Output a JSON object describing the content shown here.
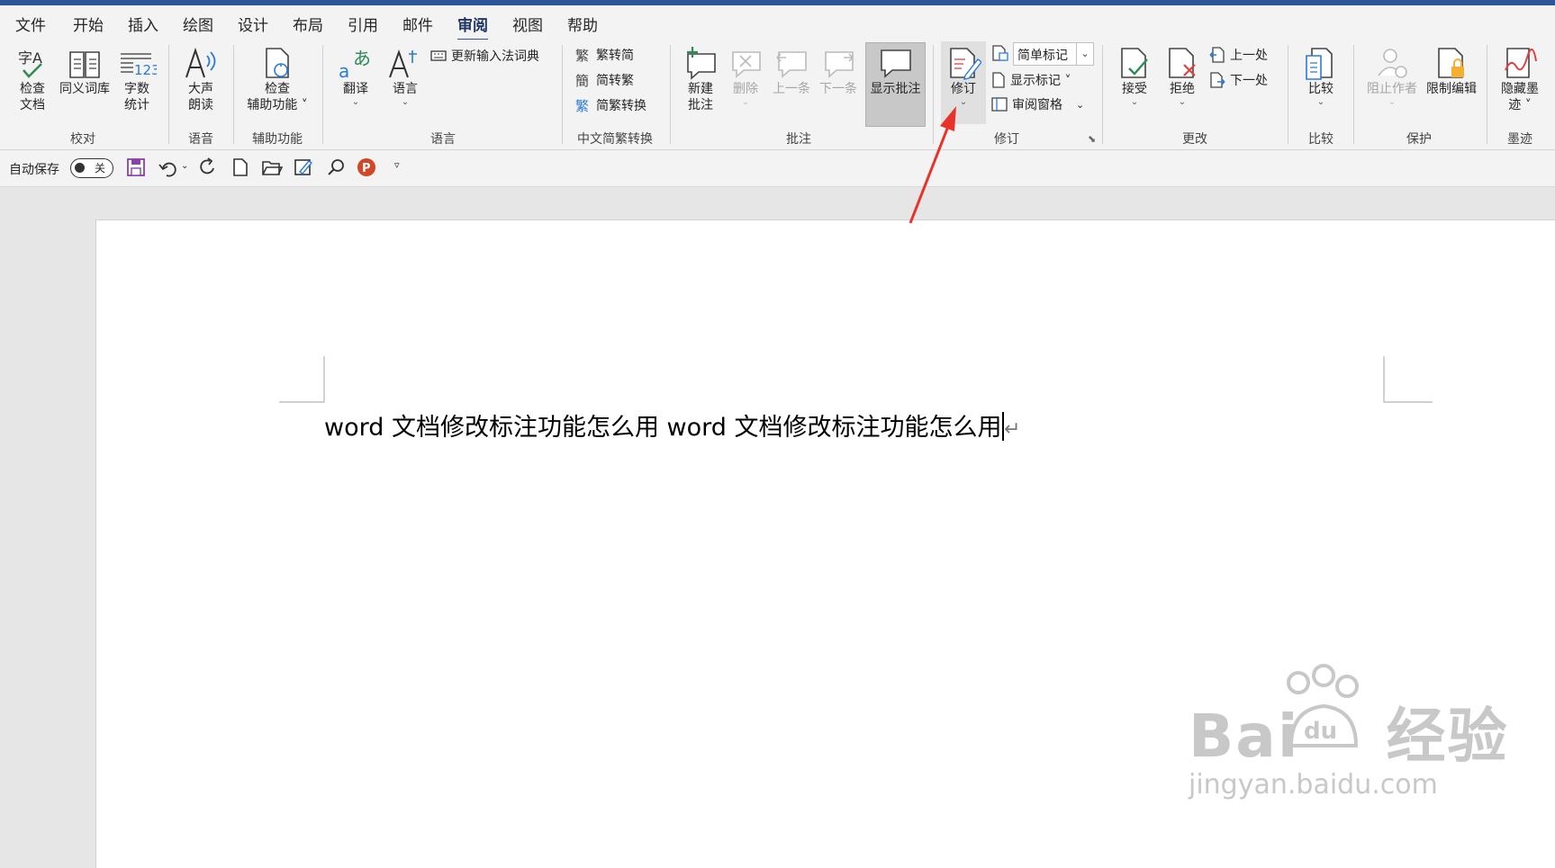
{
  "tabs": [
    {
      "label": "文件",
      "active": false
    },
    {
      "label": "开始",
      "active": false
    },
    {
      "label": "插入",
      "active": false
    },
    {
      "label": "绘图",
      "active": false
    },
    {
      "label": "设计",
      "active": false
    },
    {
      "label": "布局",
      "active": false
    },
    {
      "label": "引用",
      "active": false
    },
    {
      "label": "邮件",
      "active": false
    },
    {
      "label": "审阅",
      "active": true
    },
    {
      "label": "视图",
      "active": false
    },
    {
      "label": "帮助",
      "active": false
    }
  ],
  "ribbon": {
    "proofing": {
      "check_doc": "检查\n文档",
      "thesaurus": "同义词库",
      "word_count": "字数\n统计",
      "group": "校对",
      "icon_text_check": "字A",
      "icon_text_count": "123"
    },
    "speech": {
      "read_aloud": "大声\n朗读",
      "group": "语音"
    },
    "accessibility": {
      "check": "检查\n辅助功能 ˅",
      "group": "辅助功能"
    },
    "language": {
      "translate": "翻译",
      "language": "语言",
      "update_ime": "更新输入法词典",
      "group": "语言",
      "icon_translate_a": "a",
      "icon_translate_b": "あ"
    },
    "chinese": {
      "trad_to_simp": "繁转简",
      "simp_to_trad": "简转繁",
      "convert": "简繁转换",
      "group": "中文简繁转换",
      "icon_trad": "繁",
      "icon_simp": "簡",
      "icon_convert": "繁"
    },
    "comments": {
      "new": "新建\n批注",
      "delete": "删除",
      "previous": "上一条",
      "next": "下一条",
      "show": "显示批注",
      "group": "批注"
    },
    "tracking": {
      "track_changes": "修订",
      "markup_mode": "简单标记",
      "show_markup": "显示标记 ˅",
      "reviewing_pane": "审阅窗格",
      "group": "修订"
    },
    "changes": {
      "accept": "接受",
      "reject": "拒绝",
      "previous": "上一处",
      "next": "下一处",
      "group": "更改"
    },
    "compare": {
      "compare": "比较",
      "group": "比较"
    },
    "protect": {
      "block_authors": "阻止作者",
      "restrict_editing": "限制编辑",
      "group": "保护"
    },
    "ink": {
      "hide_ink": "隐藏墨\n迹 ˅",
      "group": "墨迹"
    }
  },
  "qat": {
    "autosave_label": "自动保存",
    "toggle_state": "关",
    "pp_icon_letter": "P"
  },
  "document": {
    "text": "word 文档修改标注功能怎么用 word 文档修改标注功能怎么用",
    "para_mark": "↵"
  },
  "watermark": {
    "brand": "Bai",
    "brand_cn": "经验",
    "url": "jingyan.baidu.com",
    "paw_text": "du"
  },
  "colors": {
    "accent": "#2b579a",
    "annotation_arrow": "#e8332a"
  }
}
